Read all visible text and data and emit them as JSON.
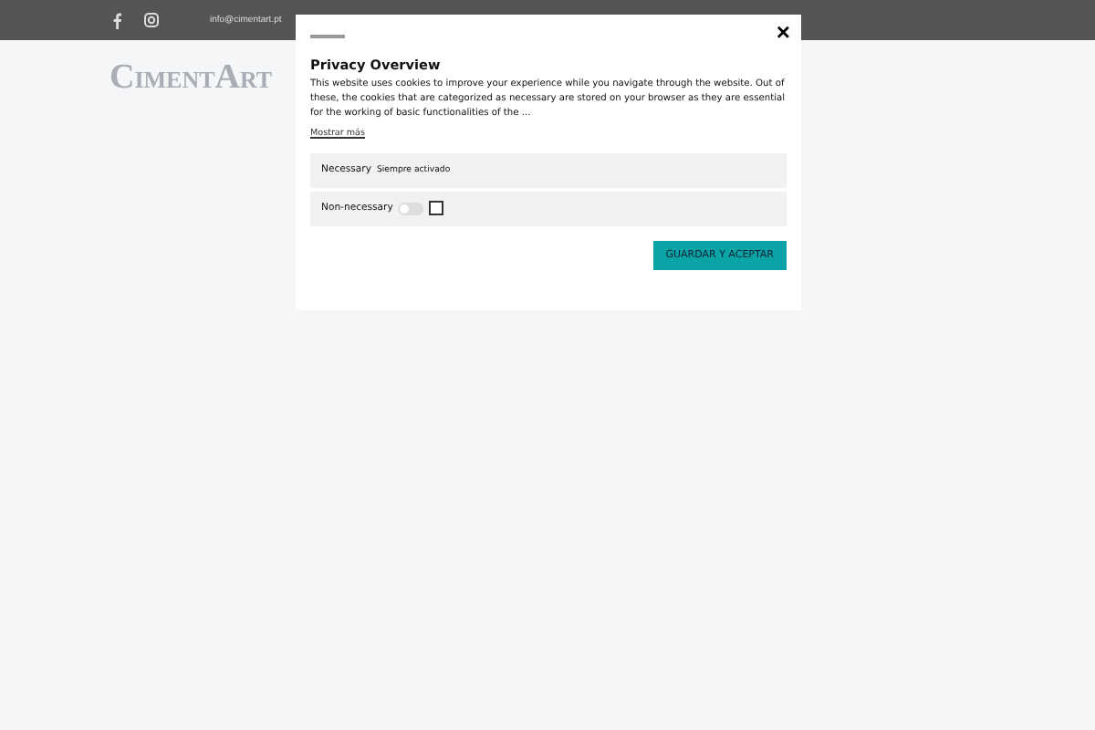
{
  "top_bar": {
    "email": "info@cimentart.pt"
  },
  "header": {
    "logo": "CimentArt"
  },
  "modal": {
    "close": "×",
    "title": "Privacy Overview",
    "text": "This website uses cookies to improve your experience while you navigate through the website. Out of these, the cookies that are categorized as necessary are stored on your browser as they are essential for the working of basic functionalities of the ...",
    "more": "Mostrar más",
    "categories": [
      {
        "kind": "always",
        "name": "Necessary",
        "status": "Siempre activado"
      },
      {
        "kind": "toggle",
        "name": "Non-necessary",
        "on": false,
        "checked": false
      }
    ],
    "button": "GUARDAR Y ACEPTAR"
  }
}
